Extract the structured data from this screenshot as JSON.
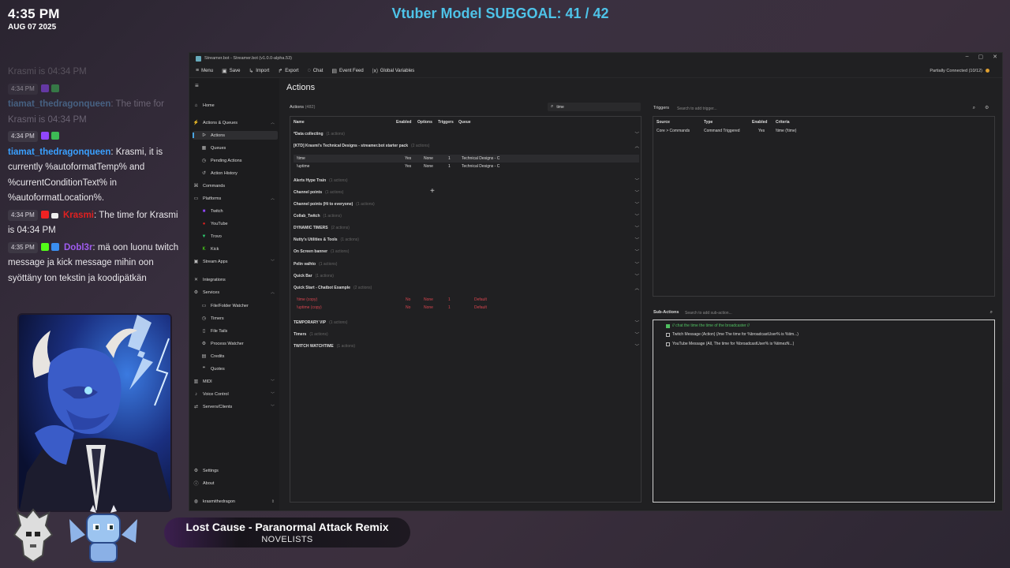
{
  "overlay": {
    "clock_time": "4:35 PM",
    "clock_date": "AUG 07 2025",
    "subgoal": "Vtuber Model SUBGOAL: 41 / 42",
    "now_playing": {
      "title": "Lost Cause - Paranormal Attack Remix",
      "artist": "NOVELISTS"
    }
  },
  "chat": [
    {
      "text": "Krasmi is 04:34 PM"
    },
    {
      "time": "4:34 PM",
      "user": "tiamat_thedragonqueen",
      "sep": ": ",
      "text": "The time for Krasmi is 04:34 PM"
    },
    {
      "time": "4:34 PM",
      "user": "tiamat_thedragonqueen",
      "sep": ": ",
      "text": "Krasmi, it is currently %autoformatTemp% and %currentConditionText% in %autoformatLocation%."
    },
    {
      "time": "4:34 PM",
      "user": "Krasmi",
      "sep": ": ",
      "text": "The time for Krasmi is 04:34 PM"
    },
    {
      "time": "4:35 PM",
      "user": "Dobl3r",
      "sep": ": ",
      "text": "mä oon luonu twitch message ja kick message mihin oon syöttäny ton tekstin ja koodipätkän"
    }
  ],
  "window": {
    "title": "Streamer.bot - Streamer.bot (v1.0.0-alpha.53)",
    "min": "–",
    "max": "▢",
    "close": "✕",
    "menu": [
      "Menu",
      "Save",
      "Import",
      "Export",
      "Chat",
      "Event Feed",
      "Global Variables"
    ],
    "status": "Partially Connected (10/12)"
  },
  "sidebar": {
    "home": "Home",
    "actions_queues": "Actions & Queues",
    "actions": "Actions",
    "queues": "Queues",
    "pending_actions": "Pending Actions",
    "action_history": "Action History",
    "commands": "Commands",
    "platforms": "Platforms",
    "twitch": "Twitch",
    "youtube": "YouTube",
    "trovo": "Trovo",
    "kick": "Kick",
    "stream_apps": "Stream Apps",
    "integrations": "Integrations",
    "services": "Services",
    "file_watcher": "File/Folder Watcher",
    "timers": "Timers",
    "file_tails": "File Tails",
    "process_watcher": "Process Watcher",
    "credits": "Credits",
    "quotes": "Quotes",
    "midi": "MIDI",
    "voice_control": "Voice Control",
    "servers_clients": "Servers/Clients",
    "settings": "Settings",
    "about": "About",
    "user": "krasmithedragon"
  },
  "actions": {
    "page_title": "Actions",
    "panel_label": "Actions",
    "panel_count": "(482)",
    "search_value": "time",
    "columns": {
      "name": "Name",
      "enabled": "Enabled",
      "options": "Options",
      "triggers": "Triggers",
      "queue": "Queue"
    },
    "groups": [
      {
        "name": "*Data collecting",
        "count": "(1 actions)"
      },
      {
        "name": "[KTD] Krasmi's Technical Designs - streamer.bot starter pack",
        "count": "(2 actions)"
      },
      {
        "name": "Alerts Hype Train",
        "count": "(1 actions)"
      },
      {
        "name": "Channel points",
        "count": "(1 actions)"
      },
      {
        "name": "Channel points (Hi to everyone)",
        "count": "(1 actions)"
      },
      {
        "name": "Collab_Twitch",
        "count": "(1 actions)"
      },
      {
        "name": "DYNAMIC TIMERS",
        "count": "(2 actions)"
      },
      {
        "name": "Nutty's Utilities & Tools",
        "count": "(1 actions)"
      },
      {
        "name": "On Screen banner",
        "count": "(1 actions)"
      },
      {
        "name": "Pelin vaihto",
        "count": "(1 actions)"
      },
      {
        "name": "Quick Bar",
        "count": "(1 actions)"
      },
      {
        "name": "Quick Start - Chatbot Example",
        "count": "(2 actions)"
      },
      {
        "name": "TEMPORARY VIP",
        "count": "(1 actions)"
      },
      {
        "name": "Timers",
        "count": "(1 actions)"
      },
      {
        "name": "TWITCH WATCHTIME",
        "count": "(1 actions)"
      }
    ],
    "ktd_rows": [
      {
        "name": "!time",
        "enabled": "Yes",
        "options": "None",
        "triggers": "1",
        "queue": "Technical Designs - C"
      },
      {
        "name": "!uptime",
        "enabled": "Yes",
        "options": "None",
        "triggers": "1",
        "queue": "Technical Designs - C"
      }
    ],
    "quickstart_rows": [
      {
        "name": "!time (copy)",
        "enabled": "No",
        "options": "None",
        "triggers": "1",
        "queue": "Default"
      },
      {
        "name": "!uptime (copy)",
        "enabled": "No",
        "options": "None",
        "triggers": "1",
        "queue": "Default"
      }
    ]
  },
  "triggers": {
    "label": "Triggers",
    "search_placeholder": "Search to add trigger...",
    "columns": {
      "source": "Source",
      "type": "Type",
      "enabled": "Enabled",
      "criteria": "Criteria"
    },
    "rows": [
      {
        "source": "Core > Commands",
        "type": "Command Triggered",
        "enabled": "Yes",
        "criteria": "!time (!time)"
      }
    ]
  },
  "subactions": {
    "label": "Sub-Actions",
    "search_placeholder": "Search to add sub-action...",
    "items": [
      "// chat the time the time of the broadcaster //",
      "Twitch Message (Action) (/me The time for %broadcastUser% is %tim...)",
      "YouTube Message (All, The time for %broadcastUser% is %timezN...)"
    ]
  },
  "colors": {
    "accent": "#4ec3e8",
    "twitch": "#9146ff",
    "kick": "#53fc18",
    "youtube": "#e02020",
    "disabled": "#d9454f"
  }
}
